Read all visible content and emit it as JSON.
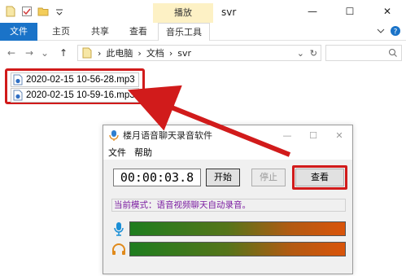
{
  "explorer": {
    "title": "svr",
    "contextual_tab_top": "播放",
    "tabs": [
      "文件",
      "主页",
      "共享",
      "查看",
      "音乐工具"
    ],
    "breadcrumb": [
      "此电脑",
      "文档",
      "svr"
    ],
    "files": [
      {
        "name": "2020-02-15 10-56-28.mp3"
      },
      {
        "name": "2020-02-15 10-59-16.mp3"
      }
    ]
  },
  "recorder": {
    "title": "楼月语音聊天录音软件",
    "menu": [
      "文件",
      "帮助"
    ],
    "timer": "00:00:03.8",
    "start_label": "开始",
    "stop_label": "停止",
    "view_label": "查看",
    "mode_text": "当前模式：语音视频聊天自动录音。"
  },
  "colors": {
    "accent_blue": "#1a73c8",
    "highlight_red": "#d11b1b",
    "mode_text": "#7a1ba0"
  },
  "icons": [
    "file-icon",
    "checkbox-icon",
    "folder-icon",
    "dropdown-icon",
    "minimize-icon",
    "maximize-icon",
    "close-icon",
    "help-icon",
    "chevron-down-icon",
    "back-arrow-icon",
    "forward-arrow-icon",
    "up-arrow-icon",
    "refresh-icon",
    "search-icon",
    "mp3-file-icon",
    "microphone-icon",
    "headphone-icon",
    "app-icon"
  ]
}
